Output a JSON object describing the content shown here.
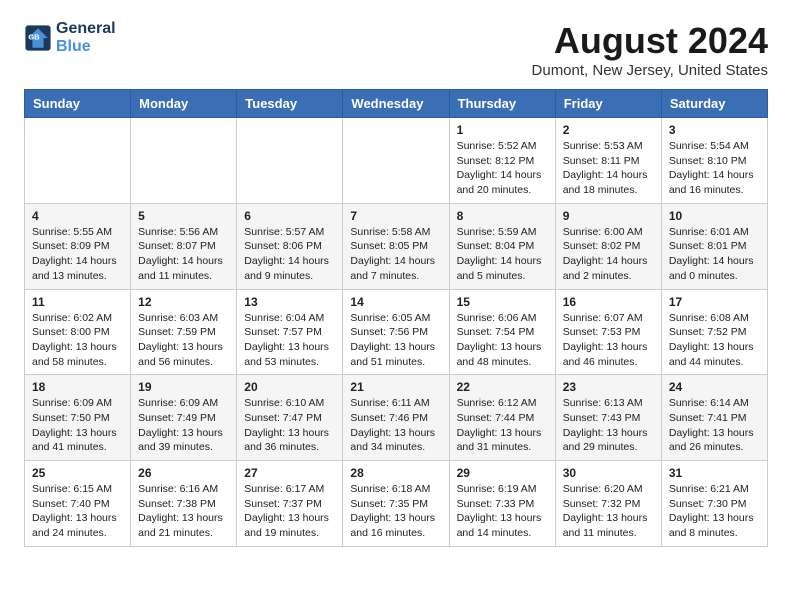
{
  "header": {
    "logo_line1": "General",
    "logo_line2": "Blue",
    "month_title": "August 2024",
    "location": "Dumont, New Jersey, United States"
  },
  "weekdays": [
    "Sunday",
    "Monday",
    "Tuesday",
    "Wednesday",
    "Thursday",
    "Friday",
    "Saturday"
  ],
  "weeks": [
    [
      {
        "day": "",
        "info": ""
      },
      {
        "day": "",
        "info": ""
      },
      {
        "day": "",
        "info": ""
      },
      {
        "day": "",
        "info": ""
      },
      {
        "day": "1",
        "info": "Sunrise: 5:52 AM\nSunset: 8:12 PM\nDaylight: 14 hours and 20 minutes."
      },
      {
        "day": "2",
        "info": "Sunrise: 5:53 AM\nSunset: 8:11 PM\nDaylight: 14 hours and 18 minutes."
      },
      {
        "day": "3",
        "info": "Sunrise: 5:54 AM\nSunset: 8:10 PM\nDaylight: 14 hours and 16 minutes."
      }
    ],
    [
      {
        "day": "4",
        "info": "Sunrise: 5:55 AM\nSunset: 8:09 PM\nDaylight: 14 hours and 13 minutes."
      },
      {
        "day": "5",
        "info": "Sunrise: 5:56 AM\nSunset: 8:07 PM\nDaylight: 14 hours and 11 minutes."
      },
      {
        "day": "6",
        "info": "Sunrise: 5:57 AM\nSunset: 8:06 PM\nDaylight: 14 hours and 9 minutes."
      },
      {
        "day": "7",
        "info": "Sunrise: 5:58 AM\nSunset: 8:05 PM\nDaylight: 14 hours and 7 minutes."
      },
      {
        "day": "8",
        "info": "Sunrise: 5:59 AM\nSunset: 8:04 PM\nDaylight: 14 hours and 5 minutes."
      },
      {
        "day": "9",
        "info": "Sunrise: 6:00 AM\nSunset: 8:02 PM\nDaylight: 14 hours and 2 minutes."
      },
      {
        "day": "10",
        "info": "Sunrise: 6:01 AM\nSunset: 8:01 PM\nDaylight: 14 hours and 0 minutes."
      }
    ],
    [
      {
        "day": "11",
        "info": "Sunrise: 6:02 AM\nSunset: 8:00 PM\nDaylight: 13 hours and 58 minutes."
      },
      {
        "day": "12",
        "info": "Sunrise: 6:03 AM\nSunset: 7:59 PM\nDaylight: 13 hours and 56 minutes."
      },
      {
        "day": "13",
        "info": "Sunrise: 6:04 AM\nSunset: 7:57 PM\nDaylight: 13 hours and 53 minutes."
      },
      {
        "day": "14",
        "info": "Sunrise: 6:05 AM\nSunset: 7:56 PM\nDaylight: 13 hours and 51 minutes."
      },
      {
        "day": "15",
        "info": "Sunrise: 6:06 AM\nSunset: 7:54 PM\nDaylight: 13 hours and 48 minutes."
      },
      {
        "day": "16",
        "info": "Sunrise: 6:07 AM\nSunset: 7:53 PM\nDaylight: 13 hours and 46 minutes."
      },
      {
        "day": "17",
        "info": "Sunrise: 6:08 AM\nSunset: 7:52 PM\nDaylight: 13 hours and 44 minutes."
      }
    ],
    [
      {
        "day": "18",
        "info": "Sunrise: 6:09 AM\nSunset: 7:50 PM\nDaylight: 13 hours and 41 minutes."
      },
      {
        "day": "19",
        "info": "Sunrise: 6:09 AM\nSunset: 7:49 PM\nDaylight: 13 hours and 39 minutes."
      },
      {
        "day": "20",
        "info": "Sunrise: 6:10 AM\nSunset: 7:47 PM\nDaylight: 13 hours and 36 minutes."
      },
      {
        "day": "21",
        "info": "Sunrise: 6:11 AM\nSunset: 7:46 PM\nDaylight: 13 hours and 34 minutes."
      },
      {
        "day": "22",
        "info": "Sunrise: 6:12 AM\nSunset: 7:44 PM\nDaylight: 13 hours and 31 minutes."
      },
      {
        "day": "23",
        "info": "Sunrise: 6:13 AM\nSunset: 7:43 PM\nDaylight: 13 hours and 29 minutes."
      },
      {
        "day": "24",
        "info": "Sunrise: 6:14 AM\nSunset: 7:41 PM\nDaylight: 13 hours and 26 minutes."
      }
    ],
    [
      {
        "day": "25",
        "info": "Sunrise: 6:15 AM\nSunset: 7:40 PM\nDaylight: 13 hours and 24 minutes."
      },
      {
        "day": "26",
        "info": "Sunrise: 6:16 AM\nSunset: 7:38 PM\nDaylight: 13 hours and 21 minutes."
      },
      {
        "day": "27",
        "info": "Sunrise: 6:17 AM\nSunset: 7:37 PM\nDaylight: 13 hours and 19 minutes."
      },
      {
        "day": "28",
        "info": "Sunrise: 6:18 AM\nSunset: 7:35 PM\nDaylight: 13 hours and 16 minutes."
      },
      {
        "day": "29",
        "info": "Sunrise: 6:19 AM\nSunset: 7:33 PM\nDaylight: 13 hours and 14 minutes."
      },
      {
        "day": "30",
        "info": "Sunrise: 6:20 AM\nSunset: 7:32 PM\nDaylight: 13 hours and 11 minutes."
      },
      {
        "day": "31",
        "info": "Sunrise: 6:21 AM\nSunset: 7:30 PM\nDaylight: 13 hours and 8 minutes."
      }
    ]
  ]
}
